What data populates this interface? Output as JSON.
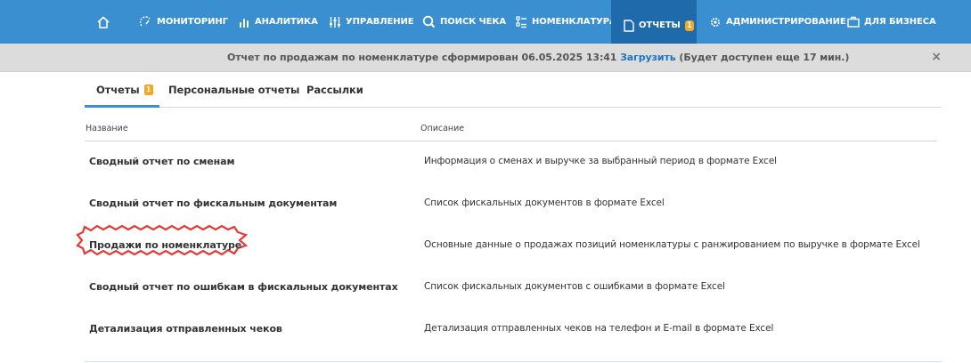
{
  "nav": {
    "home_label": "",
    "items": [
      {
        "label": "МОНИТОРИНГ",
        "icon": "monitoring-icon"
      },
      {
        "label": "АНАЛИТИКА",
        "icon": "bar-chart-icon"
      },
      {
        "label": "УПРАВЛЕНИЕ",
        "icon": "sliders-icon"
      },
      {
        "label": "ПОИСК ЧЕКА",
        "icon": "search-icon"
      },
      {
        "label": "НОМЕНКЛАТУРА",
        "icon": "nomenclature-icon"
      },
      {
        "label": "ОТЧЕТЫ",
        "icon": "document-icon",
        "badge": "1",
        "active": true
      },
      {
        "label": "АДМИНИСТРИРОВАНИЕ",
        "icon": "gear-icon"
      },
      {
        "label": "ДЛЯ БИЗНЕСА",
        "icon": "briefcase-icon"
      }
    ]
  },
  "notice": {
    "text": "Отчет по продажам по номенклатуре сформирован 06.05.2025 13:41",
    "link": "Загрузить",
    "suffix": "(Будет доступен еще 17 мин.)",
    "close": "×"
  },
  "tabs": [
    {
      "label": "Отчеты",
      "badge": "1",
      "active": true
    },
    {
      "label": "Персональные отчеты"
    },
    {
      "label": "Рассылки"
    }
  ],
  "table": {
    "columns": [
      "Название",
      "Описание"
    ],
    "rows": [
      {
        "name": "Сводный отчет по сменам",
        "description": "Информация о сменах и выручке за выбранный период в формате Excel"
      },
      {
        "name": "Сводный отчет по фискальным документам",
        "description": "Список фискальных документов в формате Excel"
      },
      {
        "name": "Продажи по номенклатуре",
        "description": "Основные данные о продажах позиций номенклатуры с ранжированием по выручке в формате Excel",
        "highlighted": true
      },
      {
        "name": "Сводный отчет по ошибкам в фискальных документах",
        "description": "Список фискальных документов с ошибками в формате Excel"
      },
      {
        "name": "Детализация отправленных чеков",
        "description": "Детализация отправленных чеков на телефон и E-mail в формате Excel"
      }
    ]
  },
  "colors": {
    "nav_bg": "#3a8fd1",
    "nav_active": "#1e6aaa",
    "badge": "#f5a623",
    "link": "#1e73be",
    "highlight": "#e53935"
  }
}
